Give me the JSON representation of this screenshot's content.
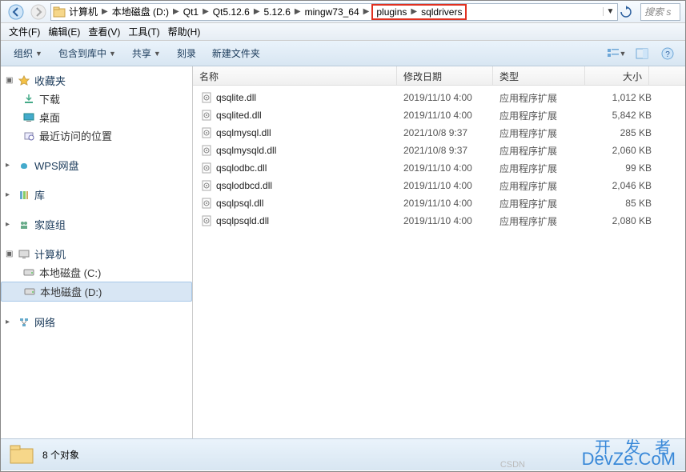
{
  "breadcrumb": {
    "segments": [
      "计算机",
      "本地磁盘 (D:)",
      "Qt1",
      "Qt5.12.6",
      "5.12.6",
      "mingw73_64",
      "plugins",
      "sqldrivers"
    ],
    "highlighted_from": 6
  },
  "search": {
    "placeholder": "搜索 s"
  },
  "menubar": {
    "file": "文件(F)",
    "edit": "编辑(E)",
    "view": "查看(V)",
    "tools": "工具(T)",
    "help": "帮助(H)"
  },
  "toolbar": {
    "organize": "组织",
    "include": "包含到库中",
    "share": "共享",
    "burn": "刻录",
    "newfolder": "新建文件夹"
  },
  "sidebar": {
    "favorites": {
      "label": "收藏夹",
      "items": [
        "下载",
        "桌面",
        "最近访问的位置"
      ]
    },
    "wps": {
      "label": "WPS网盘"
    },
    "library": {
      "label": "库"
    },
    "homegroup": {
      "label": "家庭组"
    },
    "computer": {
      "label": "计算机",
      "items": [
        "本地磁盘 (C:)",
        "本地磁盘 (D:)"
      ]
    },
    "network": {
      "label": "网络"
    }
  },
  "columns": {
    "name": "名称",
    "date": "修改日期",
    "type": "类型",
    "size": "大小"
  },
  "files": [
    {
      "name": "qsqlite.dll",
      "date": "2019/11/10 4:00",
      "type": "应用程序扩展",
      "size": "1,012 KB"
    },
    {
      "name": "qsqlited.dll",
      "date": "2019/11/10 4:00",
      "type": "应用程序扩展",
      "size": "5,842 KB"
    },
    {
      "name": "qsqlmysql.dll",
      "date": "2021/10/8 9:37",
      "type": "应用程序扩展",
      "size": "285 KB"
    },
    {
      "name": "qsqlmysqld.dll",
      "date": "2021/10/8 9:37",
      "type": "应用程序扩展",
      "size": "2,060 KB"
    },
    {
      "name": "qsqlodbc.dll",
      "date": "2019/11/10 4:00",
      "type": "应用程序扩展",
      "size": "99 KB"
    },
    {
      "name": "qsqlodbcd.dll",
      "date": "2019/11/10 4:00",
      "type": "应用程序扩展",
      "size": "2,046 KB"
    },
    {
      "name": "qsqlpsql.dll",
      "date": "2019/11/10 4:00",
      "type": "应用程序扩展",
      "size": "85 KB"
    },
    {
      "name": "qsqlpsqld.dll",
      "date": "2019/11/10 4:00",
      "type": "应用程序扩展",
      "size": "2,080 KB"
    }
  ],
  "statusbar": {
    "count": "8 个对象"
  },
  "watermark": {
    "line1": "开 发 者",
    "line2": "DevZe.CoM",
    "csdn": "CSDN"
  }
}
